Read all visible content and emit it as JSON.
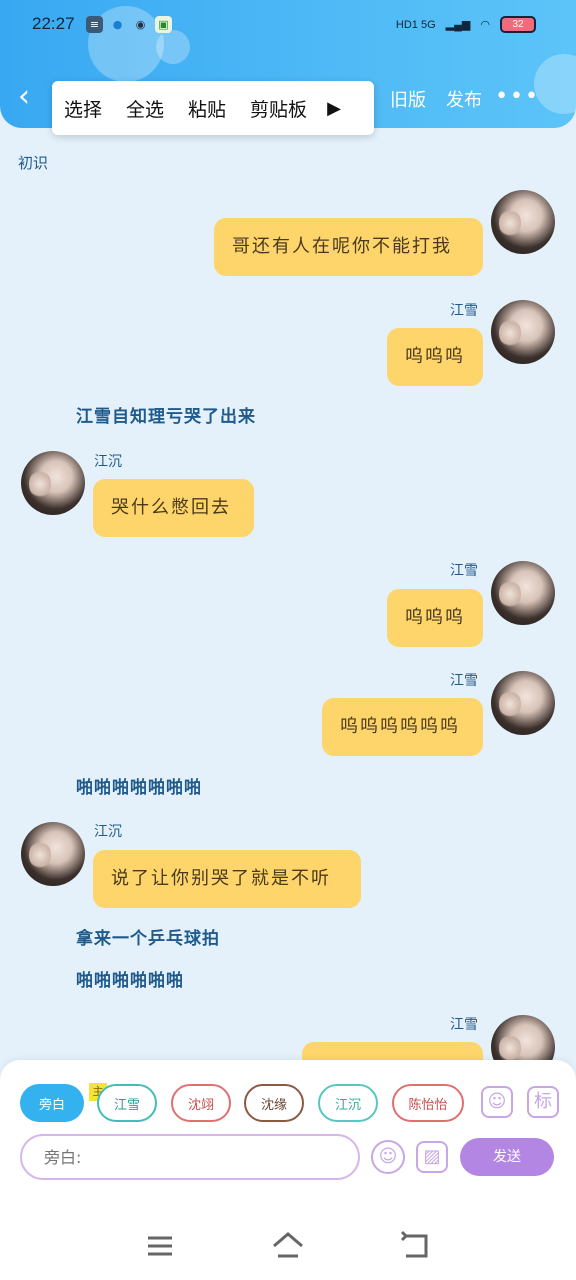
{
  "status_bar": {
    "time": "22:27",
    "signal_text": "HD1 5G",
    "battery": "32"
  },
  "header": {
    "context_menu": [
      "选择",
      "全选",
      "粘贴",
      "剪贴板"
    ],
    "old_version": "旧版",
    "publish": "发布",
    "more": "•••"
  },
  "chat": {
    "scene_label": "初识",
    "messages": [
      {
        "side": "right",
        "speaker": "江雪",
        "text": "哥还有人在呢你不能打我"
      },
      {
        "side": "right",
        "speaker": "江雪",
        "text": "呜呜呜"
      },
      {
        "side": "narration",
        "text": "江雪自知理亏哭了出来"
      },
      {
        "side": "left",
        "speaker": "江沉",
        "text": "哭什么憋回去"
      },
      {
        "side": "right",
        "speaker": "江雪",
        "text": "呜呜呜"
      },
      {
        "side": "right",
        "speaker": "江雪",
        "text": "呜呜呜呜呜呜"
      },
      {
        "side": "narration",
        "text": "啪啪啪啪啪啪啪"
      },
      {
        "side": "left",
        "speaker": "江沉",
        "text": "说了让你别哭了就是不听"
      },
      {
        "side": "narration",
        "text": "拿来一个乒乓球拍"
      },
      {
        "side": "narration",
        "text": "啪啪啪啪啪啪"
      },
      {
        "side": "right",
        "speaker": "江雪",
        "text": ""
      }
    ]
  },
  "input_panel": {
    "role_chips": [
      "旁白",
      "江雪",
      "沈翊",
      "沈缘",
      "江沉",
      "陈怡怡"
    ],
    "host_tag": "主",
    "tool_label": "标",
    "placeholder": "旁白:",
    "send_label": "发送"
  },
  "colors": {
    "header": "#38a8f2",
    "bubble": "#fdd56a",
    "chip_active": "#33b2ef",
    "send": "#b386e4"
  }
}
